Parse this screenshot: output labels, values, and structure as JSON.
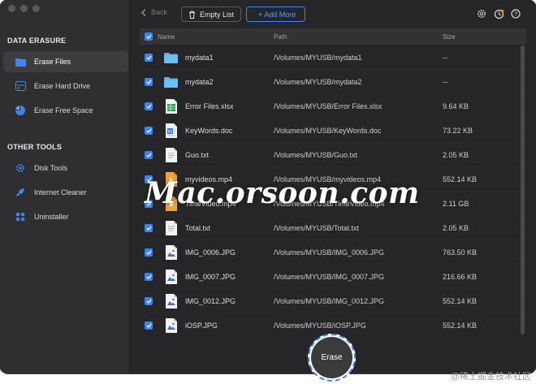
{
  "colors": {
    "accent": "#3b84f5",
    "sidebar_bg": "#2f2f31",
    "main_bg": "#262628"
  },
  "sidebar": {
    "sections": [
      {
        "title": "DATA ERASURE",
        "items": [
          {
            "label": "Erase Files",
            "icon": "folder-icon",
            "active": true
          },
          {
            "label": "Erase Hard Drive",
            "icon": "hard-drive-icon",
            "active": false
          },
          {
            "label": "Erase Free Space",
            "icon": "pie-chart-icon",
            "active": false
          }
        ]
      },
      {
        "title": "OTHER TOOLS",
        "items": [
          {
            "label": "Disk Tools",
            "icon": "gear-icon",
            "active": false
          },
          {
            "label": "Internet Cleaner",
            "icon": "rocket-icon",
            "active": false
          },
          {
            "label": "Uninstaller",
            "icon": "grid-icon",
            "active": false
          }
        ]
      }
    ]
  },
  "toolbar": {
    "back_label": "Back",
    "empty_list_label": "Empty List",
    "add_more_label": "+ Add More",
    "icons": [
      "settings-icon",
      "history-icon",
      "help-icon"
    ]
  },
  "table": {
    "columns": {
      "name": "Name",
      "path": "Path",
      "size": "Size"
    },
    "rows": [
      {
        "name": "mydata1",
        "path": "/Volumes/MYUSB/mydata1",
        "size": "--",
        "icon": "folder-icon"
      },
      {
        "name": "mydata2",
        "path": "/Volumes/MYUSB/mydata2",
        "size": "--",
        "icon": "folder-icon"
      },
      {
        "name": "Error Files.xlsx",
        "path": "/Volumes/MYUSB/Error Files.xlsx",
        "size": "9.64 KB",
        "icon": "spreadsheet-icon"
      },
      {
        "name": "KeyWords.doc",
        "path": "/Volumes/MYUSB/KeyWords.doc",
        "size": "73.22 KB",
        "icon": "word-doc-icon"
      },
      {
        "name": "Guo.txt",
        "path": "/Volumes/MYUSB/Guo.txt",
        "size": "2.05 KB",
        "icon": "text-file-icon"
      },
      {
        "name": "myvideos.mp4",
        "path": "/Volumes/MYUSB/myvideos.mp4",
        "size": "552.14 KB",
        "icon": "video-file-icon"
      },
      {
        "name": "TimeVideo.mp4",
        "path": "/Volumes/MYUSB/TimeVideo.mp4",
        "size": "2.11 GB",
        "icon": "video-file-icon"
      },
      {
        "name": "Total.txt",
        "path": "/Volumes/MYUSB/Total.txt",
        "size": "2.05 KB",
        "icon": "text-file-icon"
      },
      {
        "name": "IMG_0006.JPG",
        "path": "/Volumes/MYUSB/IMG_0006.JPG",
        "size": "763.50 KB",
        "icon": "image-file-icon"
      },
      {
        "name": "IMG_0007.JPG",
        "path": "/Volumes/MYUSB/IMG_0007.JPG",
        "size": "216.66 KB",
        "icon": "image-file-icon"
      },
      {
        "name": "IMG_0012.JPG",
        "path": "/Volumes/MYUSB/IMG_0012.JPG",
        "size": "552.14 KB",
        "icon": "image-file-icon"
      },
      {
        "name": "iOSP.JPG",
        "path": "/Volumes/MYUSB/iOSP.JPG",
        "size": "552.14 KB",
        "icon": "image-file-icon"
      }
    ]
  },
  "erase_label": "Erase",
  "watermark": "Mac.orsoon.com",
  "watermark_corner": "@稀土掘金技术社区"
}
